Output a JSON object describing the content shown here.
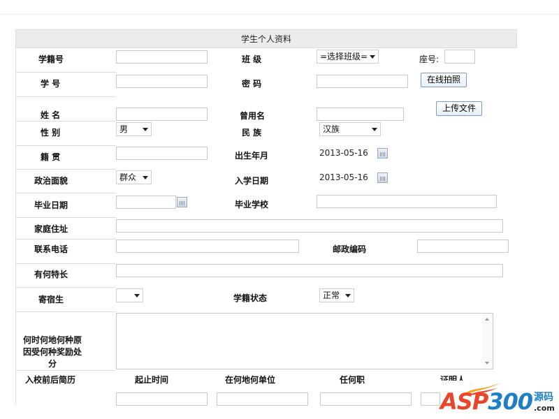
{
  "form": {
    "title": "学生个人资料",
    "labels": {
      "xuejihao": "学籍号",
      "banji": "班 级",
      "zuohao": "座号:",
      "xuehao": "学 号",
      "mima": "密 码",
      "xingming": "姓 名",
      "cengyongming": "曾用名",
      "xingbie": "性 别",
      "minzu": "民 族",
      "jiguan": "籍 贯",
      "chushengnianyue": "出生年月",
      "zhengzhimianmao": "政治面貌",
      "ruxueriqi": "入学日期",
      "biyeriqi": "毕业日期",
      "biyexuexiao": "毕业学校",
      "jiatingzhuzhi": "家庭住址",
      "lianxidianhua": "联系电话",
      "youzhengbianma": "邮政编码",
      "youhetechang": "有何特长",
      "jisusheng": "寄宿生",
      "xuejizhuangtai": "学籍状态",
      "jiangli_1": "何时何地何种原",
      "jiangli_2": "因受何种奖励处",
      "jiangli_3": "分",
      "ruxiaojianli": "入校前后简历",
      "qizhishijian": "起止时间",
      "zaihedanwei": "在何地何单位",
      "renhezhi": "任何职",
      "zhengmingren": "证明人"
    },
    "selects": {
      "banji": "=选择班级=",
      "xingbie": "男",
      "minzu": "汉族",
      "zhengzhimianmao": "群众",
      "jisusheng": "",
      "xuejizhuangtai": "正常"
    },
    "values": {
      "chushengnianyue": "2013-05-16",
      "ruxueriqi": "2013-05-16"
    },
    "buttons": {
      "paizhao": "在线拍照",
      "shangchuan": "上传文件"
    }
  },
  "watermark": {
    "text_asp": "ASP",
    "text_num": "300",
    "cn": "源码",
    "com": ".com"
  }
}
